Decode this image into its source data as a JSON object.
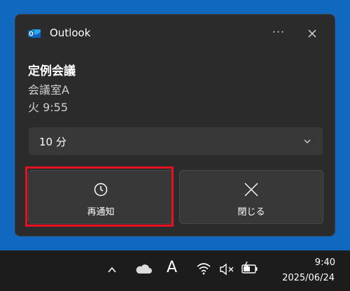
{
  "notification": {
    "app_name": "Outlook",
    "app_icon": "outlook-icon",
    "more_label": "···",
    "title": "定例会議",
    "location": "会議室A",
    "time": "火 9:55",
    "snooze_duration": "10 分",
    "snooze_label": "再通知",
    "dismiss_label": "閉じる",
    "highlight_color": "#e81123"
  },
  "taskbar": {
    "ime_indicator": "A",
    "clock_time": "9:40",
    "clock_date": "2025/06/24",
    "tray_icons": [
      "chevron-up-icon",
      "onedrive-icon",
      "ime-icon",
      "wifi-icon",
      "volume-muted-icon",
      "battery-charging-icon"
    ]
  },
  "colors": {
    "desktop": "#1169bf",
    "toast_bg": "#2b2b2b",
    "button_bg": "#383838"
  }
}
